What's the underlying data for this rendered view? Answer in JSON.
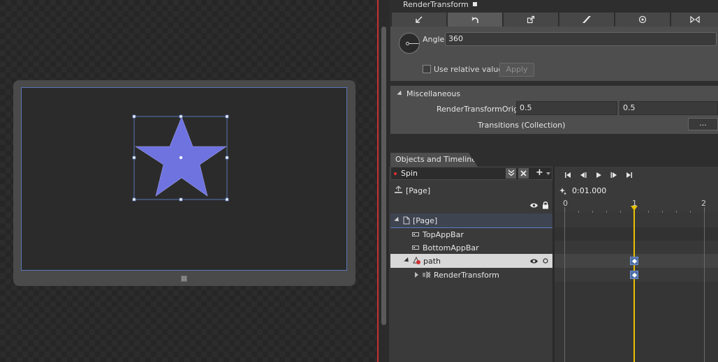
{
  "render_transform": {
    "title": "RenderTransform",
    "tabs": [
      {
        "name": "translate",
        "icon": "translate-arrow-icon"
      },
      {
        "name": "rotate",
        "icon": "rotate-arrow-icon",
        "active": true
      },
      {
        "name": "scale",
        "icon": "scale-icon"
      },
      {
        "name": "skew",
        "icon": "skew-icon"
      },
      {
        "name": "center-point",
        "icon": "center-point-icon"
      },
      {
        "name": "flip",
        "icon": "flip-icon"
      }
    ],
    "angle_label": "Angle",
    "angle_value": "360",
    "relative_values_label": "Use relative values",
    "relative_values_checked": false,
    "apply_label": "Apply"
  },
  "miscellaneous": {
    "header": "Miscellaneous",
    "origin_label": "RenderTransformOrigin",
    "origin_x": "0.5",
    "origin_y": "0.5",
    "transitions_label": "Transitions (Collection)",
    "transitions_button": "..."
  },
  "objects_timeline": {
    "tab_label": "Objects and Timeline",
    "storyboard_name": "Spin",
    "scope_label": "[Page]",
    "current_time": "0:01.000",
    "ruler_labels": [
      "0",
      "1",
      "2"
    ],
    "tree": {
      "page": "[Page]",
      "top_app_bar": "TopAppBar",
      "bottom_app_bar": "BottomAppBar",
      "path": "path",
      "render_transform": "RenderTransform"
    }
  },
  "colors": {
    "star_fill": "#6f73e0",
    "selection": "#5a77b8",
    "playhead": "#e8c000",
    "keyframe": "#4d6ea6",
    "red_divider": "#c8302f"
  }
}
